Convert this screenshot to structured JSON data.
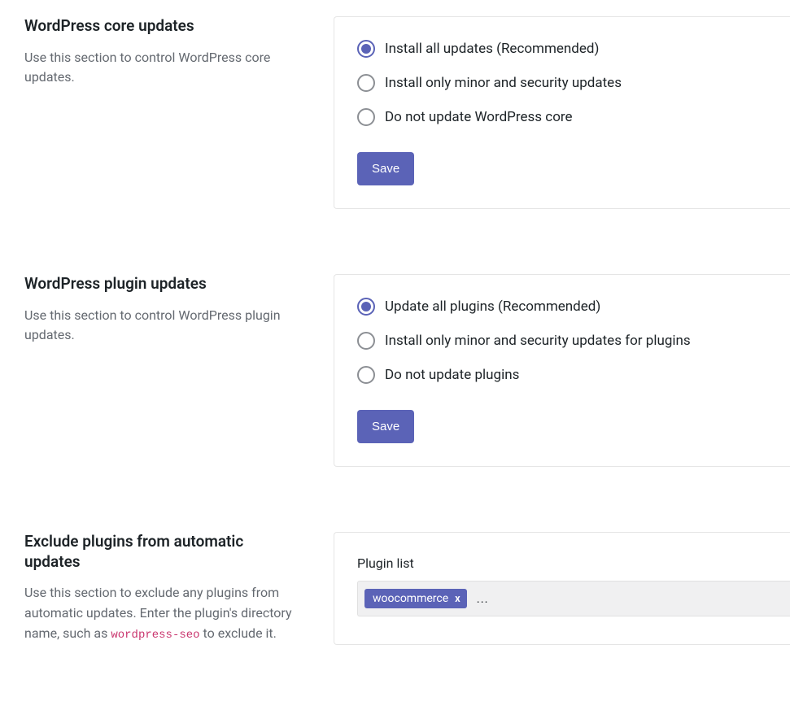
{
  "sections": {
    "core": {
      "title": "WordPress core updates",
      "desc": "Use this section to control WordPress core updates.",
      "options": [
        {
          "label": "Install all updates (Recommended)",
          "checked": true
        },
        {
          "label": "Install only minor and security updates",
          "checked": false
        },
        {
          "label": "Do not update WordPress core",
          "checked": false
        }
      ],
      "save_label": "Save"
    },
    "plugins": {
      "title": "WordPress plugin updates",
      "desc": "Use this section to control WordPress plugin updates.",
      "options": [
        {
          "label": "Update all plugins (Recommended)",
          "checked": true
        },
        {
          "label": "Install only minor and security updates for plugins",
          "checked": false
        },
        {
          "label": "Do not update plugins",
          "checked": false
        }
      ],
      "save_label": "Save"
    },
    "exclude": {
      "title": "Exclude plugins from automatic updates",
      "desc_prefix": "Use this section to exclude any plugins from automatic updates. Enter the plugin's directory name, such as ",
      "desc_code": "wordpress-seo",
      "desc_suffix": " to exclude it.",
      "field_label": "Plugin list",
      "tags": [
        {
          "name": "woocommerce"
        }
      ],
      "tag_remove_glyph": "x",
      "typing_value": "..."
    }
  }
}
